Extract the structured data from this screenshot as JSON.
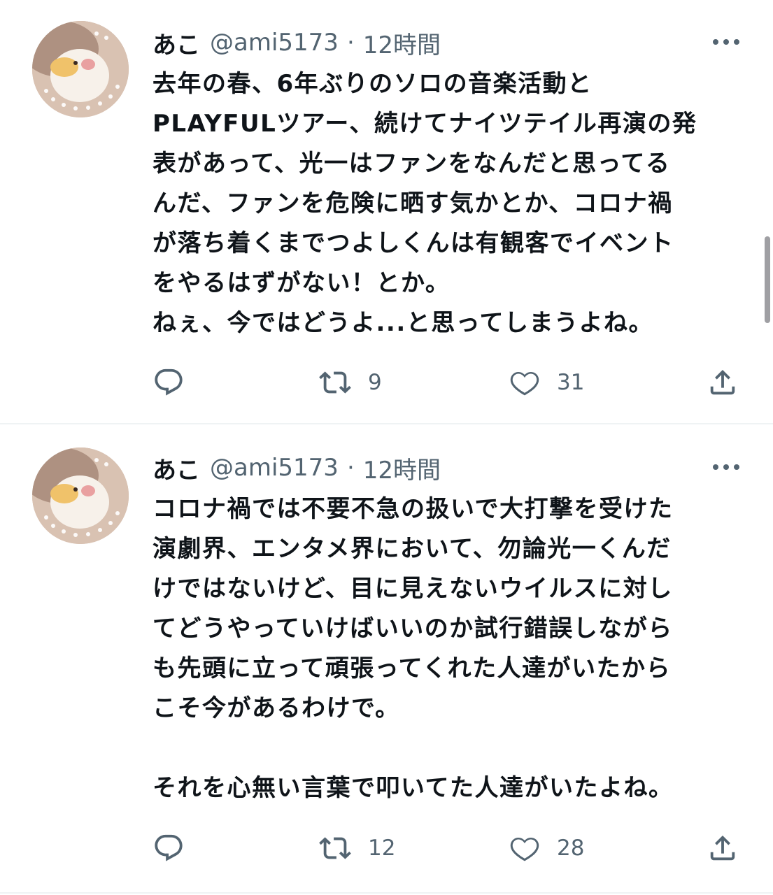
{
  "tweets": [
    {
      "display_name": "あこ",
      "handle": "@ami5173",
      "separator": "·",
      "time": "12時間",
      "lines": [
        "去年の春、6年ぶりのソロの音楽活動と",
        "PLAYFULツアー、続けてナイツテイル再演の発",
        "表があって、光一はファンをなんだと思ってる",
        "んだ、ファンを危険に晒す気かとか、コロナ禍",
        "が落ち着くまでつよしくんは有観客でイベント",
        "をやるはずがない！とか。",
        "ねぇ、今ではどうよ...と思ってしまうよね。"
      ],
      "retweets": "9",
      "likes": "31"
    },
    {
      "display_name": "あこ",
      "handle": "@ami5173",
      "separator": "·",
      "time": "12時間",
      "lines": [
        "コロナ禍では不要不急の扱いで大打撃を受けた",
        "演劇界、エンタメ界において、勿論光一くんだ",
        "けではないけど、目に見えないウイルスに対し",
        "てどうやっていけばいいのか試行錯誤しながら",
        "も先頭に立って頑張ってくれた人達がいたから",
        "こそ今があるわけで。",
        "",
        "それを心無い言葉で叩いてた人達がいたよね。"
      ],
      "retweets": "12",
      "likes": "28"
    }
  ],
  "icons": {
    "more": "more-dots-icon",
    "reply": "reply-icon",
    "retweet": "retweet-icon",
    "like": "heart-icon",
    "share": "share-icon"
  },
  "colors": {
    "text": "#0f1419",
    "secondary": "#536471",
    "divider": "#eff3f4"
  }
}
